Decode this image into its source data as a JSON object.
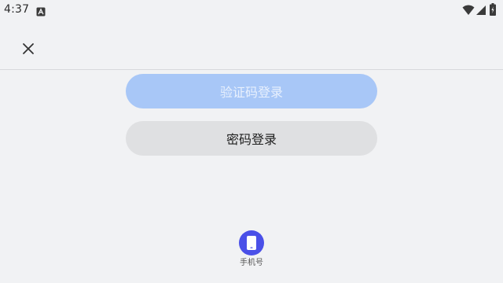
{
  "status_bar": {
    "time": "4:37",
    "notification_icon": "a-letter-icon",
    "wifi_icon": "wifi-icon",
    "signal_icon": "cellular-signal-icon",
    "battery_icon": "battery-icon"
  },
  "top_bar": {
    "close_icon": "close-icon"
  },
  "login": {
    "sms_login_label": "验证码登录",
    "password_login_label": "密码登录"
  },
  "bottom_options": {
    "phone_label": "手机号",
    "phone_icon": "mobile-phone-icon"
  },
  "colors": {
    "background": "#f1f2f4",
    "sms_button_bg": "#a8c7f7",
    "password_button_bg": "#dfe0e2",
    "phone_icon_bg": "#4a50e8"
  }
}
